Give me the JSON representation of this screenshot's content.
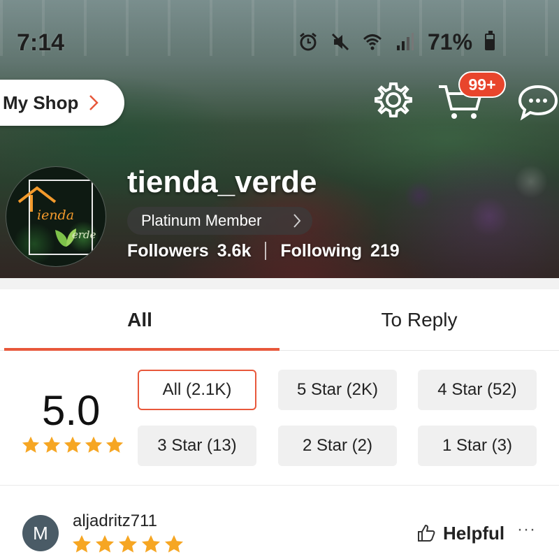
{
  "status_bar": {
    "time": "7:14",
    "battery": "71%",
    "icons": [
      "alarm-icon",
      "mute-icon",
      "wifi-icon",
      "signal-icon",
      "battery-icon"
    ]
  },
  "header": {
    "my_shop_label": "My Shop",
    "cart_badge": "99+",
    "icons": [
      "gear-icon",
      "cart-icon",
      "chat-icon"
    ]
  },
  "shop": {
    "name": "tienda_verde",
    "logo_text_top": "ienda",
    "logo_text_bottom": "erde",
    "membership": "Platinum Member",
    "followers_label": "Followers",
    "followers_value": "3.6k",
    "following_label": "Following",
    "following_value": "219"
  },
  "tabs": [
    {
      "label": "All",
      "active": true
    },
    {
      "label": "To Reply",
      "active": false
    }
  ],
  "rating": {
    "score": "5.0",
    "stars": 5,
    "filters": [
      {
        "label": "All (2.1K)",
        "selected": true
      },
      {
        "label": "5 Star (2K)",
        "selected": false
      },
      {
        "label": "4 Star (52)",
        "selected": false
      },
      {
        "label": "3 Star (13)",
        "selected": false
      },
      {
        "label": "2 Star (2)",
        "selected": false
      },
      {
        "label": "1 Star (3)",
        "selected": false
      }
    ]
  },
  "review": {
    "avatar_initial": "M",
    "username": "aljadritz711",
    "stars": 5,
    "helpful_label": "Helpful",
    "more_label": "···"
  },
  "colors": {
    "accent": "#e8583b",
    "badge": "#e8452c",
    "star": "#f6a623",
    "filter_bg": "#f0f0f0",
    "avatar_bg": "#4a5b66"
  }
}
